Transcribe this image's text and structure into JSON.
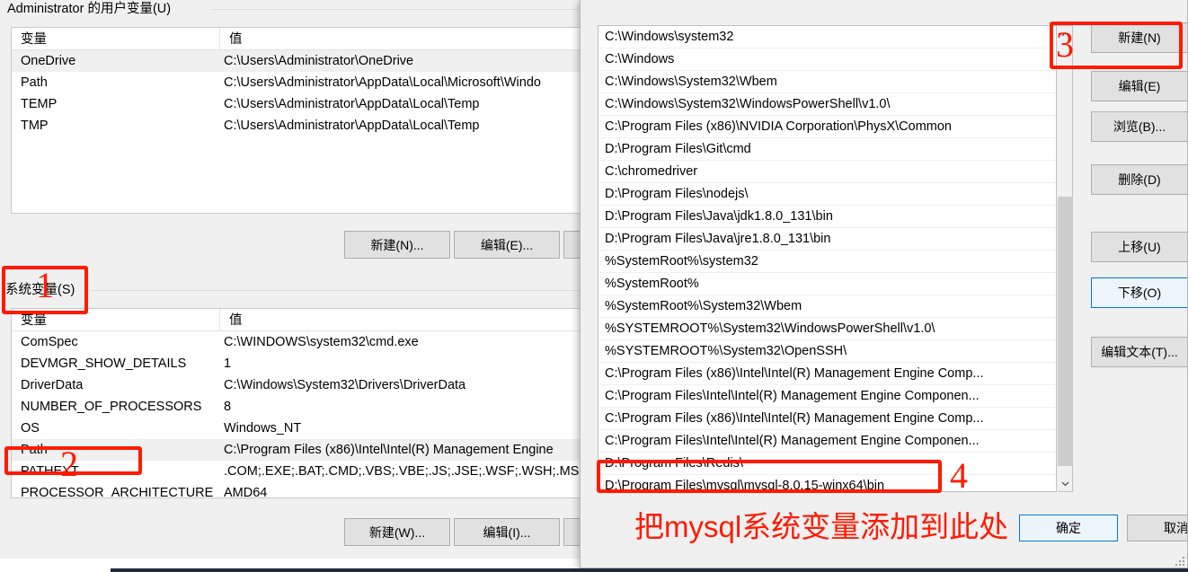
{
  "back_dialog": {
    "user_vars": {
      "group_label": "Administrator 的用户变量(U)",
      "group_label_access_key": "U",
      "columns": {
        "name": "变量",
        "value": "值"
      },
      "rows": [
        {
          "name": "OneDrive",
          "value": "C:\\Users\\Administrator\\OneDrive",
          "selected": true
        },
        {
          "name": "Path",
          "value": "C:\\Users\\Administrator\\AppData\\Local\\Microsoft\\Windo",
          "selected": false
        },
        {
          "name": "TEMP",
          "value": "C:\\Users\\Administrator\\AppData\\Local\\Temp",
          "selected": false
        },
        {
          "name": "TMP",
          "value": "C:\\Users\\Administrator\\AppData\\Local\\Temp",
          "selected": false
        }
      ],
      "buttons": {
        "new": "新建(N)...",
        "edit": "编辑(E)..."
      }
    },
    "system_vars": {
      "group_label": "系统变量(S)",
      "columns": {
        "name": "变量",
        "value": "值"
      },
      "rows": [
        {
          "name": "ComSpec",
          "value": "C:\\WINDOWS\\system32\\cmd.exe",
          "selected": false
        },
        {
          "name": "DEVMGR_SHOW_DETAILS",
          "value": "1",
          "selected": false
        },
        {
          "name": "DriverData",
          "value": "C:\\Windows\\System32\\Drivers\\DriverData",
          "selected": false
        },
        {
          "name": "NUMBER_OF_PROCESSORS",
          "value": "8",
          "selected": false
        },
        {
          "name": "OS",
          "value": "Windows_NT",
          "selected": false
        },
        {
          "name": "Path",
          "value": "C:\\Program Files (x86)\\Intel\\Intel(R) Management Engine",
          "selected": true
        },
        {
          "name": "PATHEXT",
          "value": ".COM;.EXE;.BAT;.CMD;.VBS;.VBE;.JS;.JSE;.WSF;.WSH;.MSC",
          "selected": false
        },
        {
          "name": "PROCESSOR_ARCHITECTURE",
          "value": "AMD64",
          "selected": false
        }
      ],
      "buttons": {
        "new": "新建(W)...",
        "edit": "编辑(I)..."
      }
    }
  },
  "front_dialog": {
    "path_entries": [
      "C:\\Windows\\system32",
      "C:\\Windows",
      "C:\\Windows\\System32\\Wbem",
      "C:\\Windows\\System32\\WindowsPowerShell\\v1.0\\",
      "C:\\Program Files (x86)\\NVIDIA Corporation\\PhysX\\Common",
      "D:\\Program Files\\Git\\cmd",
      "C:\\chromedriver",
      "D:\\Program Files\\nodejs\\",
      "D:\\Program Files\\Java\\jdk1.8.0_131\\bin",
      "D:\\Program Files\\Java\\jre1.8.0_131\\bin",
      "%SystemRoot%\\system32",
      "%SystemRoot%",
      "%SystemRoot%\\System32\\Wbem",
      "%SYSTEMROOT%\\System32\\WindowsPowerShell\\v1.0\\",
      "%SYSTEMROOT%\\System32\\OpenSSH\\",
      "C:\\Program Files (x86)\\Intel\\Intel(R) Management Engine Comp...",
      "C:\\Program Files\\Intel\\Intel(R) Management Engine Componen...",
      "C:\\Program Files (x86)\\Intel\\Intel(R) Management Engine Comp...",
      "C:\\Program Files\\Intel\\Intel(R) Management Engine Componen...",
      "D:\\Program Files\\Redis\\",
      "D:\\Program Files\\mysql\\mysql-8.0.15-winx64\\bin",
      ""
    ],
    "side_buttons": [
      {
        "label": "新建(N)",
        "default": false
      },
      {
        "label": "编辑(E)",
        "default": false
      },
      {
        "label": "浏览(B)...",
        "default": false
      },
      {
        "label": "删除(D)",
        "default": false
      },
      {
        "label": "上移(U)",
        "default": false
      },
      {
        "label": "下移(O)",
        "default": true
      },
      {
        "label": "编辑文本(T)...",
        "default": false
      }
    ],
    "footer_buttons": {
      "ok": "确定",
      "cancel": "取消"
    },
    "scrollbar": {
      "up_glyph": "⌃",
      "down_glyph": "⌄"
    }
  },
  "annotations": {
    "numbers": [
      "1",
      "2",
      "3",
      "4"
    ],
    "note_text": "把mysql系统变量添加到此处",
    "color": "#ff1a00"
  }
}
